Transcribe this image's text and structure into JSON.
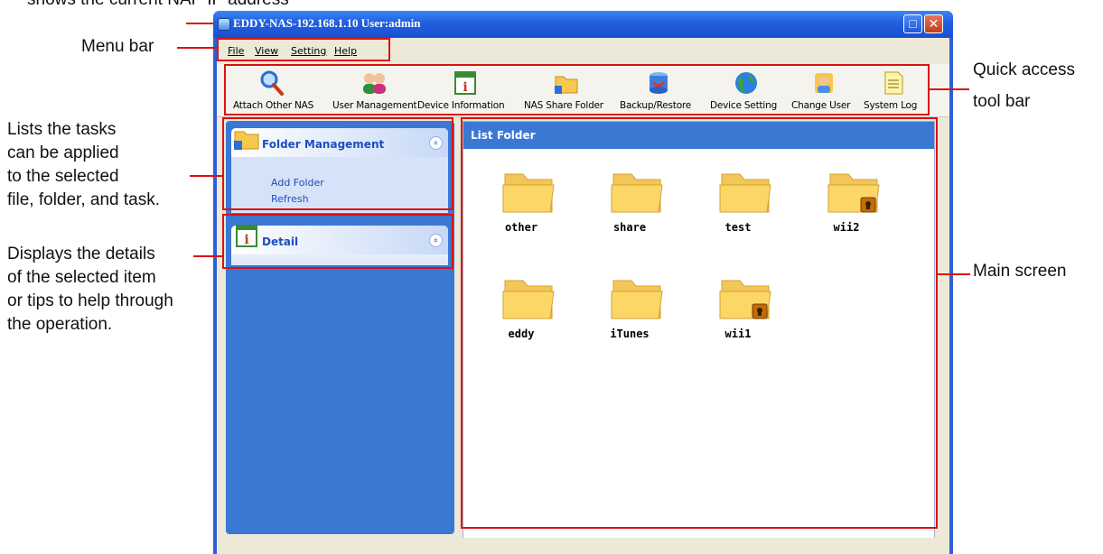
{
  "annotations": {
    "top_partial": "shows the current NAP IP address",
    "menu_bar": "Menu bar",
    "quick_access_line1": "Quick access",
    "quick_access_line2": "tool bar",
    "tasks_line1": "Lists the tasks",
    "tasks_line2": "can be applied",
    "tasks_line3": "to the selected",
    "tasks_line4": "file, folder, and task.",
    "details_line1": "Displays the details",
    "details_line2": "of the selected item",
    "details_line3": "or tips to help through",
    "details_line4": "the operation.",
    "main_screen": "Main screen"
  },
  "window": {
    "title": "EDDY-NAS-192.168.1.10 User:admin",
    "maximize_glyph": "□",
    "close_glyph": "✕"
  },
  "menu": {
    "items": [
      "File",
      "View",
      "Setting",
      "Help"
    ]
  },
  "toolbar": {
    "items": [
      {
        "label": "Attach Other NAS",
        "icon": "magnifier-icon"
      },
      {
        "label": "User Management",
        "icon": "users-icon"
      },
      {
        "label": "Device Information",
        "icon": "info-calendar-icon"
      },
      {
        "label": "NAS Share Folder",
        "icon": "share-folder-icon"
      },
      {
        "label": "Backup/Restore",
        "icon": "backup-icon"
      },
      {
        "label": "Device Setting",
        "icon": "globe-icon"
      },
      {
        "label": "Change User",
        "icon": "change-user-icon"
      },
      {
        "label": "System Log",
        "icon": "log-icon"
      }
    ]
  },
  "left_panel": {
    "folder_management": {
      "title": "Folder Management",
      "tasks": [
        "Add Folder",
        "Refresh"
      ],
      "collapse_glyph": "«"
    },
    "detail": {
      "title": "Detail",
      "collapse_glyph": "«"
    }
  },
  "main": {
    "title": "List Folder",
    "folders": [
      {
        "name": "other",
        "locked": false
      },
      {
        "name": "share",
        "locked": false
      },
      {
        "name": "test",
        "locked": false
      },
      {
        "name": "wii2",
        "locked": true
      },
      {
        "name": "eddy",
        "locked": false
      },
      {
        "name": "iTunes",
        "locked": false
      },
      {
        "name": "wii1",
        "locked": true
      }
    ]
  },
  "colors": {
    "titlebar": "#2361e0",
    "pane_blue": "#3a78d4",
    "annotation_red": "#dd1111",
    "folder_yellow": "#fcd768"
  }
}
